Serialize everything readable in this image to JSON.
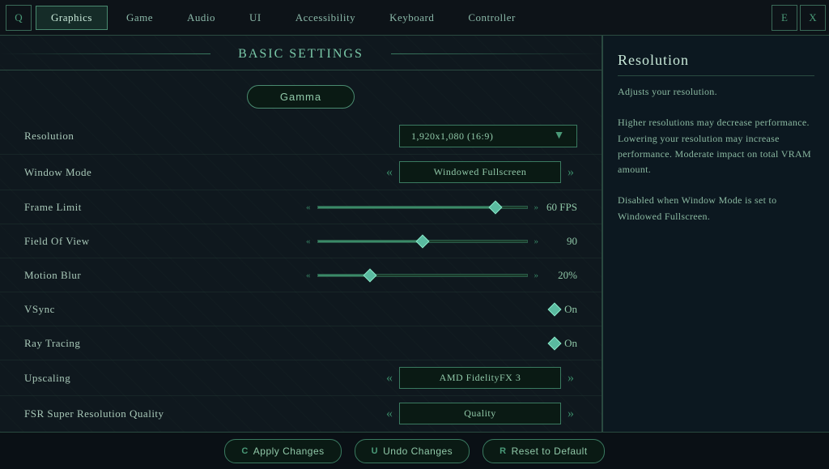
{
  "nav": {
    "q_icon": "Q",
    "e_icon": "E",
    "x_icon": "X",
    "tabs": [
      {
        "label": "Graphics",
        "active": true
      },
      {
        "label": "Game",
        "active": false
      },
      {
        "label": "Audio",
        "active": false
      },
      {
        "label": "UI",
        "active": false
      },
      {
        "label": "Accessibility",
        "active": false
      },
      {
        "label": "Keyboard",
        "active": false
      },
      {
        "label": "Controller",
        "active": false
      }
    ]
  },
  "main": {
    "section_title": "Basic Settings",
    "gamma_label": "Gamma",
    "settings": [
      {
        "label": "Resolution",
        "type": "dropdown",
        "value": "1,920x1,080 (16:9)"
      },
      {
        "label": "Window Mode",
        "type": "arrow",
        "value": "Windowed Fullscreen"
      },
      {
        "label": "Frame Limit",
        "type": "slider",
        "value": "60 FPS",
        "fill_pct": 85
      },
      {
        "label": "Field Of View",
        "type": "slider",
        "value": "90",
        "fill_pct": 50
      },
      {
        "label": "Motion Blur",
        "type": "slider",
        "value": "20%",
        "fill_pct": 25
      },
      {
        "label": "VSync",
        "type": "toggle",
        "value": "On"
      },
      {
        "label": "Ray Tracing",
        "type": "toggle",
        "value": "On"
      },
      {
        "label": "Upscaling",
        "type": "arrow",
        "value": "AMD FidelityFX 3"
      },
      {
        "label": "FSR Super Resolution Quality",
        "type": "arrow",
        "value": "Quality"
      }
    ]
  },
  "info": {
    "title": "Resolution",
    "text": "Adjusts your resolution.\n\nHigher resolutions may decrease performance. Lowering your resolution may increase performance. Moderate impact on total VRAM amount.\n\nDisabled when Window Mode is set to Windowed Fullscreen."
  },
  "bottom": {
    "apply_key": "C",
    "apply_label": "Apply Changes",
    "undo_key": "U",
    "undo_label": "Undo Changes",
    "reset_key": "R",
    "reset_label": "Reset to Default"
  }
}
